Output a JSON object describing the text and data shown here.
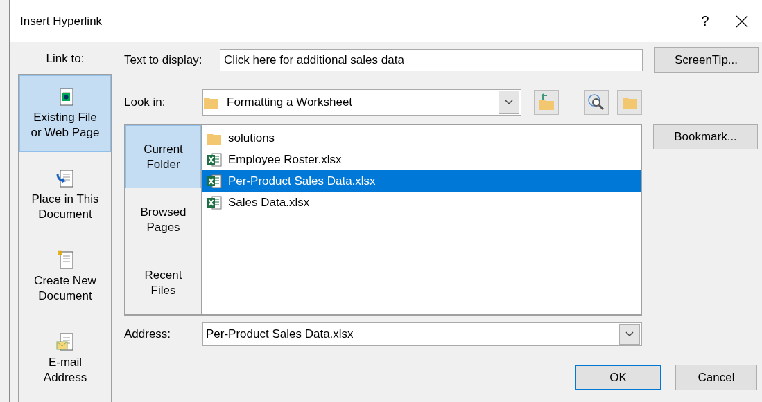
{
  "window": {
    "title": "Insert Hyperlink",
    "help": "?"
  },
  "link_to": {
    "label": "Link to:",
    "items": [
      {
        "label": "Existing File\nor Web Page",
        "kind": "file",
        "selected": true
      },
      {
        "label": "Place in This\nDocument",
        "kind": "place",
        "selected": false
      },
      {
        "label": "Create New\nDocument",
        "kind": "new",
        "selected": false
      },
      {
        "label": "E-mail\nAddress",
        "kind": "email",
        "selected": false
      }
    ]
  },
  "text_to_display": {
    "label": "Text to display:",
    "value": "Click here for additional sales data"
  },
  "screentip_button": "ScreenTip...",
  "look_in": {
    "label": "Look in:",
    "value": "Formatting a Worksheet"
  },
  "browse_nav": [
    {
      "label": "Current\nFolder",
      "selected": true
    },
    {
      "label": "Browsed\nPages",
      "selected": false
    },
    {
      "label": "Recent\nFiles",
      "selected": false
    }
  ],
  "files": [
    {
      "name": "solutions",
      "kind": "folder",
      "selected": false
    },
    {
      "name": "Employee Roster.xlsx",
      "kind": "excel",
      "selected": false
    },
    {
      "name": "Per-Product Sales Data.xlsx",
      "kind": "excel",
      "selected": true
    },
    {
      "name": "Sales Data.xlsx",
      "kind": "excel",
      "selected": false
    }
  ],
  "bookmark_button": "Bookmark...",
  "address": {
    "label": "Address:",
    "value": "Per-Product Sales Data.xlsx"
  },
  "buttons": [
    {
      "label": "OK",
      "default": true
    },
    {
      "label": "Cancel",
      "default": false
    }
  ]
}
